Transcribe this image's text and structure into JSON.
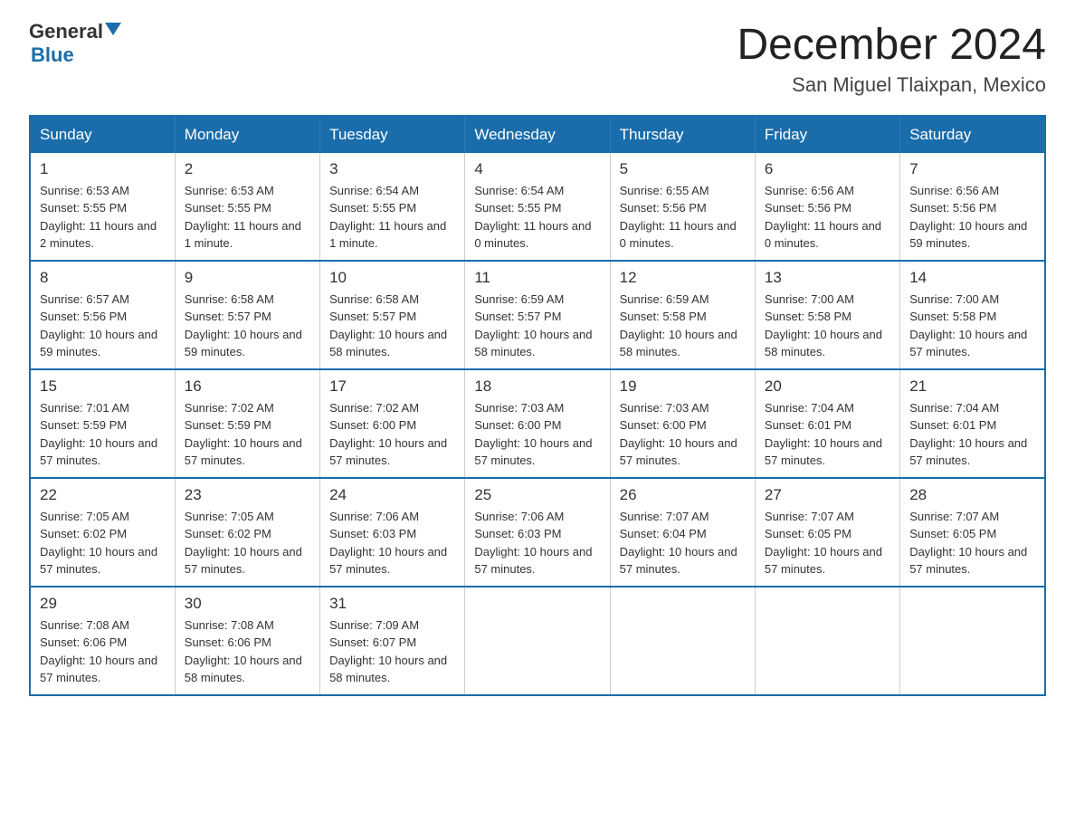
{
  "logo": {
    "general": "General",
    "blue": "Blue"
  },
  "header": {
    "month": "December 2024",
    "location": "San Miguel Tlaixpan, Mexico"
  },
  "days_of_week": [
    "Sunday",
    "Monday",
    "Tuesday",
    "Wednesday",
    "Thursday",
    "Friday",
    "Saturday"
  ],
  "weeks": [
    [
      {
        "num": "1",
        "sunrise": "6:53 AM",
        "sunset": "5:55 PM",
        "daylight": "11 hours and 2 minutes."
      },
      {
        "num": "2",
        "sunrise": "6:53 AM",
        "sunset": "5:55 PM",
        "daylight": "11 hours and 1 minute."
      },
      {
        "num": "3",
        "sunrise": "6:54 AM",
        "sunset": "5:55 PM",
        "daylight": "11 hours and 1 minute."
      },
      {
        "num": "4",
        "sunrise": "6:54 AM",
        "sunset": "5:55 PM",
        "daylight": "11 hours and 0 minutes."
      },
      {
        "num": "5",
        "sunrise": "6:55 AM",
        "sunset": "5:56 PM",
        "daylight": "11 hours and 0 minutes."
      },
      {
        "num": "6",
        "sunrise": "6:56 AM",
        "sunset": "5:56 PM",
        "daylight": "11 hours and 0 minutes."
      },
      {
        "num": "7",
        "sunrise": "6:56 AM",
        "sunset": "5:56 PM",
        "daylight": "10 hours and 59 minutes."
      }
    ],
    [
      {
        "num": "8",
        "sunrise": "6:57 AM",
        "sunset": "5:56 PM",
        "daylight": "10 hours and 59 minutes."
      },
      {
        "num": "9",
        "sunrise": "6:58 AM",
        "sunset": "5:57 PM",
        "daylight": "10 hours and 59 minutes."
      },
      {
        "num": "10",
        "sunrise": "6:58 AM",
        "sunset": "5:57 PM",
        "daylight": "10 hours and 58 minutes."
      },
      {
        "num": "11",
        "sunrise": "6:59 AM",
        "sunset": "5:57 PM",
        "daylight": "10 hours and 58 minutes."
      },
      {
        "num": "12",
        "sunrise": "6:59 AM",
        "sunset": "5:58 PM",
        "daylight": "10 hours and 58 minutes."
      },
      {
        "num": "13",
        "sunrise": "7:00 AM",
        "sunset": "5:58 PM",
        "daylight": "10 hours and 58 minutes."
      },
      {
        "num": "14",
        "sunrise": "7:00 AM",
        "sunset": "5:58 PM",
        "daylight": "10 hours and 57 minutes."
      }
    ],
    [
      {
        "num": "15",
        "sunrise": "7:01 AM",
        "sunset": "5:59 PM",
        "daylight": "10 hours and 57 minutes."
      },
      {
        "num": "16",
        "sunrise": "7:02 AM",
        "sunset": "5:59 PM",
        "daylight": "10 hours and 57 minutes."
      },
      {
        "num": "17",
        "sunrise": "7:02 AM",
        "sunset": "6:00 PM",
        "daylight": "10 hours and 57 minutes."
      },
      {
        "num": "18",
        "sunrise": "7:03 AM",
        "sunset": "6:00 PM",
        "daylight": "10 hours and 57 minutes."
      },
      {
        "num": "19",
        "sunrise": "7:03 AM",
        "sunset": "6:00 PM",
        "daylight": "10 hours and 57 minutes."
      },
      {
        "num": "20",
        "sunrise": "7:04 AM",
        "sunset": "6:01 PM",
        "daylight": "10 hours and 57 minutes."
      },
      {
        "num": "21",
        "sunrise": "7:04 AM",
        "sunset": "6:01 PM",
        "daylight": "10 hours and 57 minutes."
      }
    ],
    [
      {
        "num": "22",
        "sunrise": "7:05 AM",
        "sunset": "6:02 PM",
        "daylight": "10 hours and 57 minutes."
      },
      {
        "num": "23",
        "sunrise": "7:05 AM",
        "sunset": "6:02 PM",
        "daylight": "10 hours and 57 minutes."
      },
      {
        "num": "24",
        "sunrise": "7:06 AM",
        "sunset": "6:03 PM",
        "daylight": "10 hours and 57 minutes."
      },
      {
        "num": "25",
        "sunrise": "7:06 AM",
        "sunset": "6:03 PM",
        "daylight": "10 hours and 57 minutes."
      },
      {
        "num": "26",
        "sunrise": "7:07 AM",
        "sunset": "6:04 PM",
        "daylight": "10 hours and 57 minutes."
      },
      {
        "num": "27",
        "sunrise": "7:07 AM",
        "sunset": "6:05 PM",
        "daylight": "10 hours and 57 minutes."
      },
      {
        "num": "28",
        "sunrise": "7:07 AM",
        "sunset": "6:05 PM",
        "daylight": "10 hours and 57 minutes."
      }
    ],
    [
      {
        "num": "29",
        "sunrise": "7:08 AM",
        "sunset": "6:06 PM",
        "daylight": "10 hours and 57 minutes."
      },
      {
        "num": "30",
        "sunrise": "7:08 AM",
        "sunset": "6:06 PM",
        "daylight": "10 hours and 58 minutes."
      },
      {
        "num": "31",
        "sunrise": "7:09 AM",
        "sunset": "6:07 PM",
        "daylight": "10 hours and 58 minutes."
      },
      {
        "num": "",
        "sunrise": "",
        "sunset": "",
        "daylight": ""
      },
      {
        "num": "",
        "sunrise": "",
        "sunset": "",
        "daylight": ""
      },
      {
        "num": "",
        "sunrise": "",
        "sunset": "",
        "daylight": ""
      },
      {
        "num": "",
        "sunrise": "",
        "sunset": "",
        "daylight": ""
      }
    ]
  ]
}
